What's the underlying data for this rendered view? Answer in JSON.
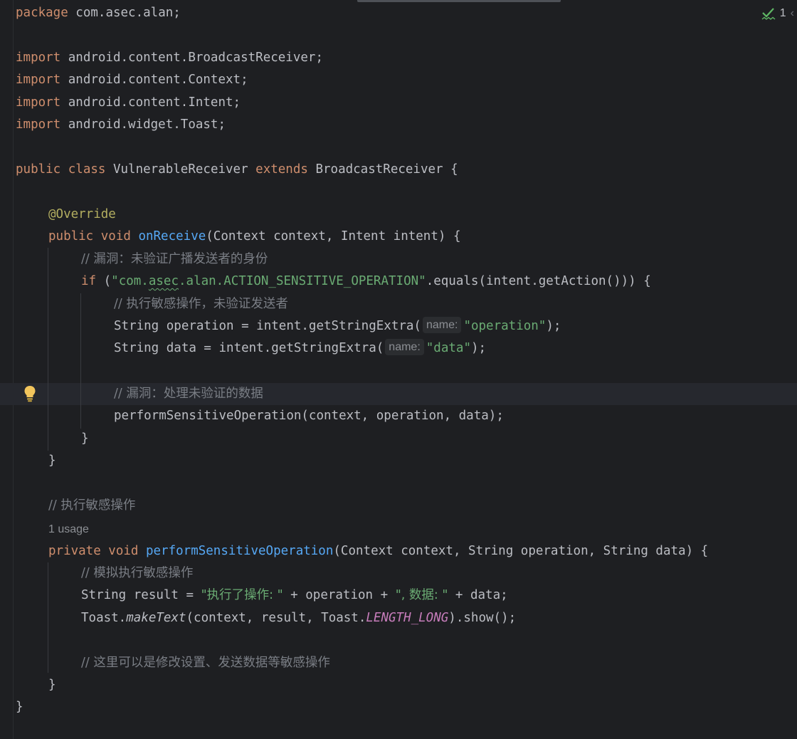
{
  "inspection": {
    "icon": "check-inspection-icon",
    "count": "1",
    "color": "#5fb865"
  },
  "code": {
    "package_kw": "package",
    "package_name": " com.asec.alan;",
    "import_kw": "import",
    "imports": [
      " android.content.BroadcastReceiver;",
      " android.content.Context;",
      " android.content.Intent;",
      " android.widget.Toast;"
    ],
    "class_public": "public",
    "class_kw": " class",
    "class_name": " VulnerableReceiver ",
    "extends_kw": "extends",
    "class_super": " BroadcastReceiver {",
    "override": "@Override",
    "recv_public": "public",
    "recv_void": " void ",
    "recv_name": "onReceive",
    "recv_params": "(Context context, Intent intent) {",
    "cmt1": "// 漏洞：未验证广播发送者的身份",
    "if_kw": "if",
    "if_paren": " (",
    "if_str_a": "\"com.",
    "if_str_b": "asec",
    "if_str_c": ".alan.ACTION_SENSITIVE_OPERATION\"",
    "if_rest": ".equals(intent.getAction())) {",
    "cmt2": "// 执行敏感操作，未验证发送者",
    "op_decl": "String operation = intent.getStringExtra(",
    "hint_name": "name:",
    "op_str": "\"operation\"",
    "op_end": ");",
    "data_decl": "String data = intent.getStringExtra(",
    "data_str": "\"data\"",
    "data_end": ");",
    "cmt3": "// 漏洞：处理未验证的数据",
    "perform_call": "performSensitiveOperation(context, operation, data);",
    "close_brace": "}",
    "cmt4": "// 执行敏感操作",
    "usage": "1 usage",
    "priv_kw": "private",
    "priv_void": " void ",
    "priv_name": "performSensitiveOperation",
    "priv_params": "(Context context, String operation, String data) {",
    "cmt5": "// 模拟执行敏感操作",
    "result_decl": "String result = ",
    "result_str1": "\"执行了操作: \"",
    "result_mid": " + operation + ",
    "result_str2": "\", 数据: \"",
    "result_end": " + data;",
    "toast_a": "Toast.",
    "toast_make": "makeText",
    "toast_b": "(context, result, Toast.",
    "toast_const": "LENGTH_LONG",
    "toast_c": ").show();",
    "cmt6": "// 这里可以是修改设置、发送数据等敏感操作"
  },
  "colors": {
    "background": "#1e1f22",
    "keyword": "#cf8e6d",
    "string": "#6aab73",
    "function": "#56a8f5",
    "comment": "#7a7e85",
    "annotation": "#b3ae60",
    "static_field": "#c77dbb"
  },
  "gutter_icons": [
    "lightbulb-icon"
  ]
}
